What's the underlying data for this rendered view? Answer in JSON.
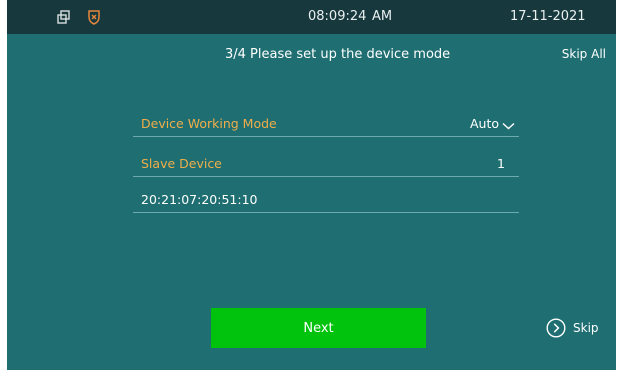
{
  "status_bar": {
    "icons": [
      "window-restore-icon",
      "shield-x-icon"
    ],
    "time": "08:09:24",
    "ampm": "AM",
    "date": "17-11-2021"
  },
  "header": {
    "title": "3/4 Please set up the device mode",
    "skip_all": "Skip All"
  },
  "form": {
    "working_mode": {
      "label": "Device Working Mode",
      "value": "Auto"
    },
    "slave_device": {
      "label": "Slave Device",
      "value": "1"
    },
    "mac_address": "20:21:07:20:51:10"
  },
  "actions": {
    "next": "Next",
    "skip": "Skip"
  },
  "colors": {
    "background": "#1f6f72",
    "status_bar": "#17383d",
    "accent_label": "#efad4a",
    "next_button": "#01c20d"
  }
}
